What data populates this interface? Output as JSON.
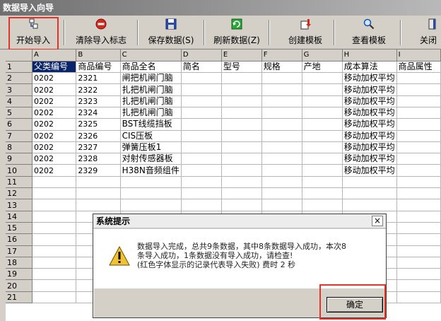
{
  "window": {
    "title": "数据导入向导"
  },
  "toolbar": {
    "start_import": "开始导入",
    "clear_flag": "清除导入标志",
    "save_data": "保存数据(S)",
    "refresh_data": "刷新数据(Z)",
    "create_template": "创建模板",
    "view_template": "查看模板",
    "close": "关闭"
  },
  "grid": {
    "col_letters": [
      "A",
      "B",
      "C",
      "D",
      "E",
      "F",
      "G",
      "H",
      "I"
    ],
    "row_numbers": [
      "1",
      "2",
      "3",
      "4",
      "5",
      "6",
      "7",
      "8",
      "9",
      "10",
      "11",
      "12",
      "13",
      "14",
      "15",
      "16",
      "17",
      "18",
      "19",
      "20",
      "21"
    ],
    "header_row": [
      "父类编号",
      "商品编号",
      "商品全名",
      "简名",
      "型号",
      "规格",
      "产地",
      "成本算法",
      "商品属性"
    ],
    "rows": [
      [
        "0202",
        "2321",
        "闸把机闸门脑",
        "",
        "",
        "",
        "",
        "移动加权平均",
        ""
      ],
      [
        "0202",
        "2322",
        "扎把机闸门脑",
        "",
        "",
        "",
        "",
        "移动加权平均",
        ""
      ],
      [
        "0202",
        "2323",
        "扎把机闸门脑",
        "",
        "",
        "",
        "",
        "移动加权平均",
        ""
      ],
      [
        "0202",
        "2324",
        "扎把机闸门脑",
        "",
        "",
        "",
        "",
        "移动加权平均",
        ""
      ],
      [
        "0202",
        "2325",
        "BST线缆挡板",
        "",
        "",
        "",
        "",
        "移动加权平均",
        ""
      ],
      [
        "0202",
        "2326",
        "CIS压板",
        "",
        "",
        "",
        "",
        "移动加权平均",
        ""
      ],
      [
        "0202",
        "2327",
        "弹簧压板1",
        "",
        "",
        "",
        "",
        "移动加权平均",
        ""
      ],
      [
        "0202",
        "2328",
        "对射传感器板",
        "",
        "",
        "",
        "",
        "移动加权平均",
        ""
      ],
      [
        "0202",
        "2329",
        "H38N音频组件",
        "",
        "",
        "",
        "",
        "移动加权平均",
        ""
      ]
    ]
  },
  "dialog": {
    "title": "系统提示",
    "close_glyph": "×",
    "message_line1": "数据导入完成，总共9条数据，其中8条数据导入成功，本次8",
    "message_line2": "条导入成功，1条数据没有导入成功，请检查!",
    "message_line3": "(红色字体显示的记录代表导入失败) 费时 2 秒",
    "ok_label": "确定"
  },
  "colors": {
    "highlight_box": "#e0352b",
    "selected_cell": "#0a246a",
    "warning_icon": "#f2c230"
  }
}
